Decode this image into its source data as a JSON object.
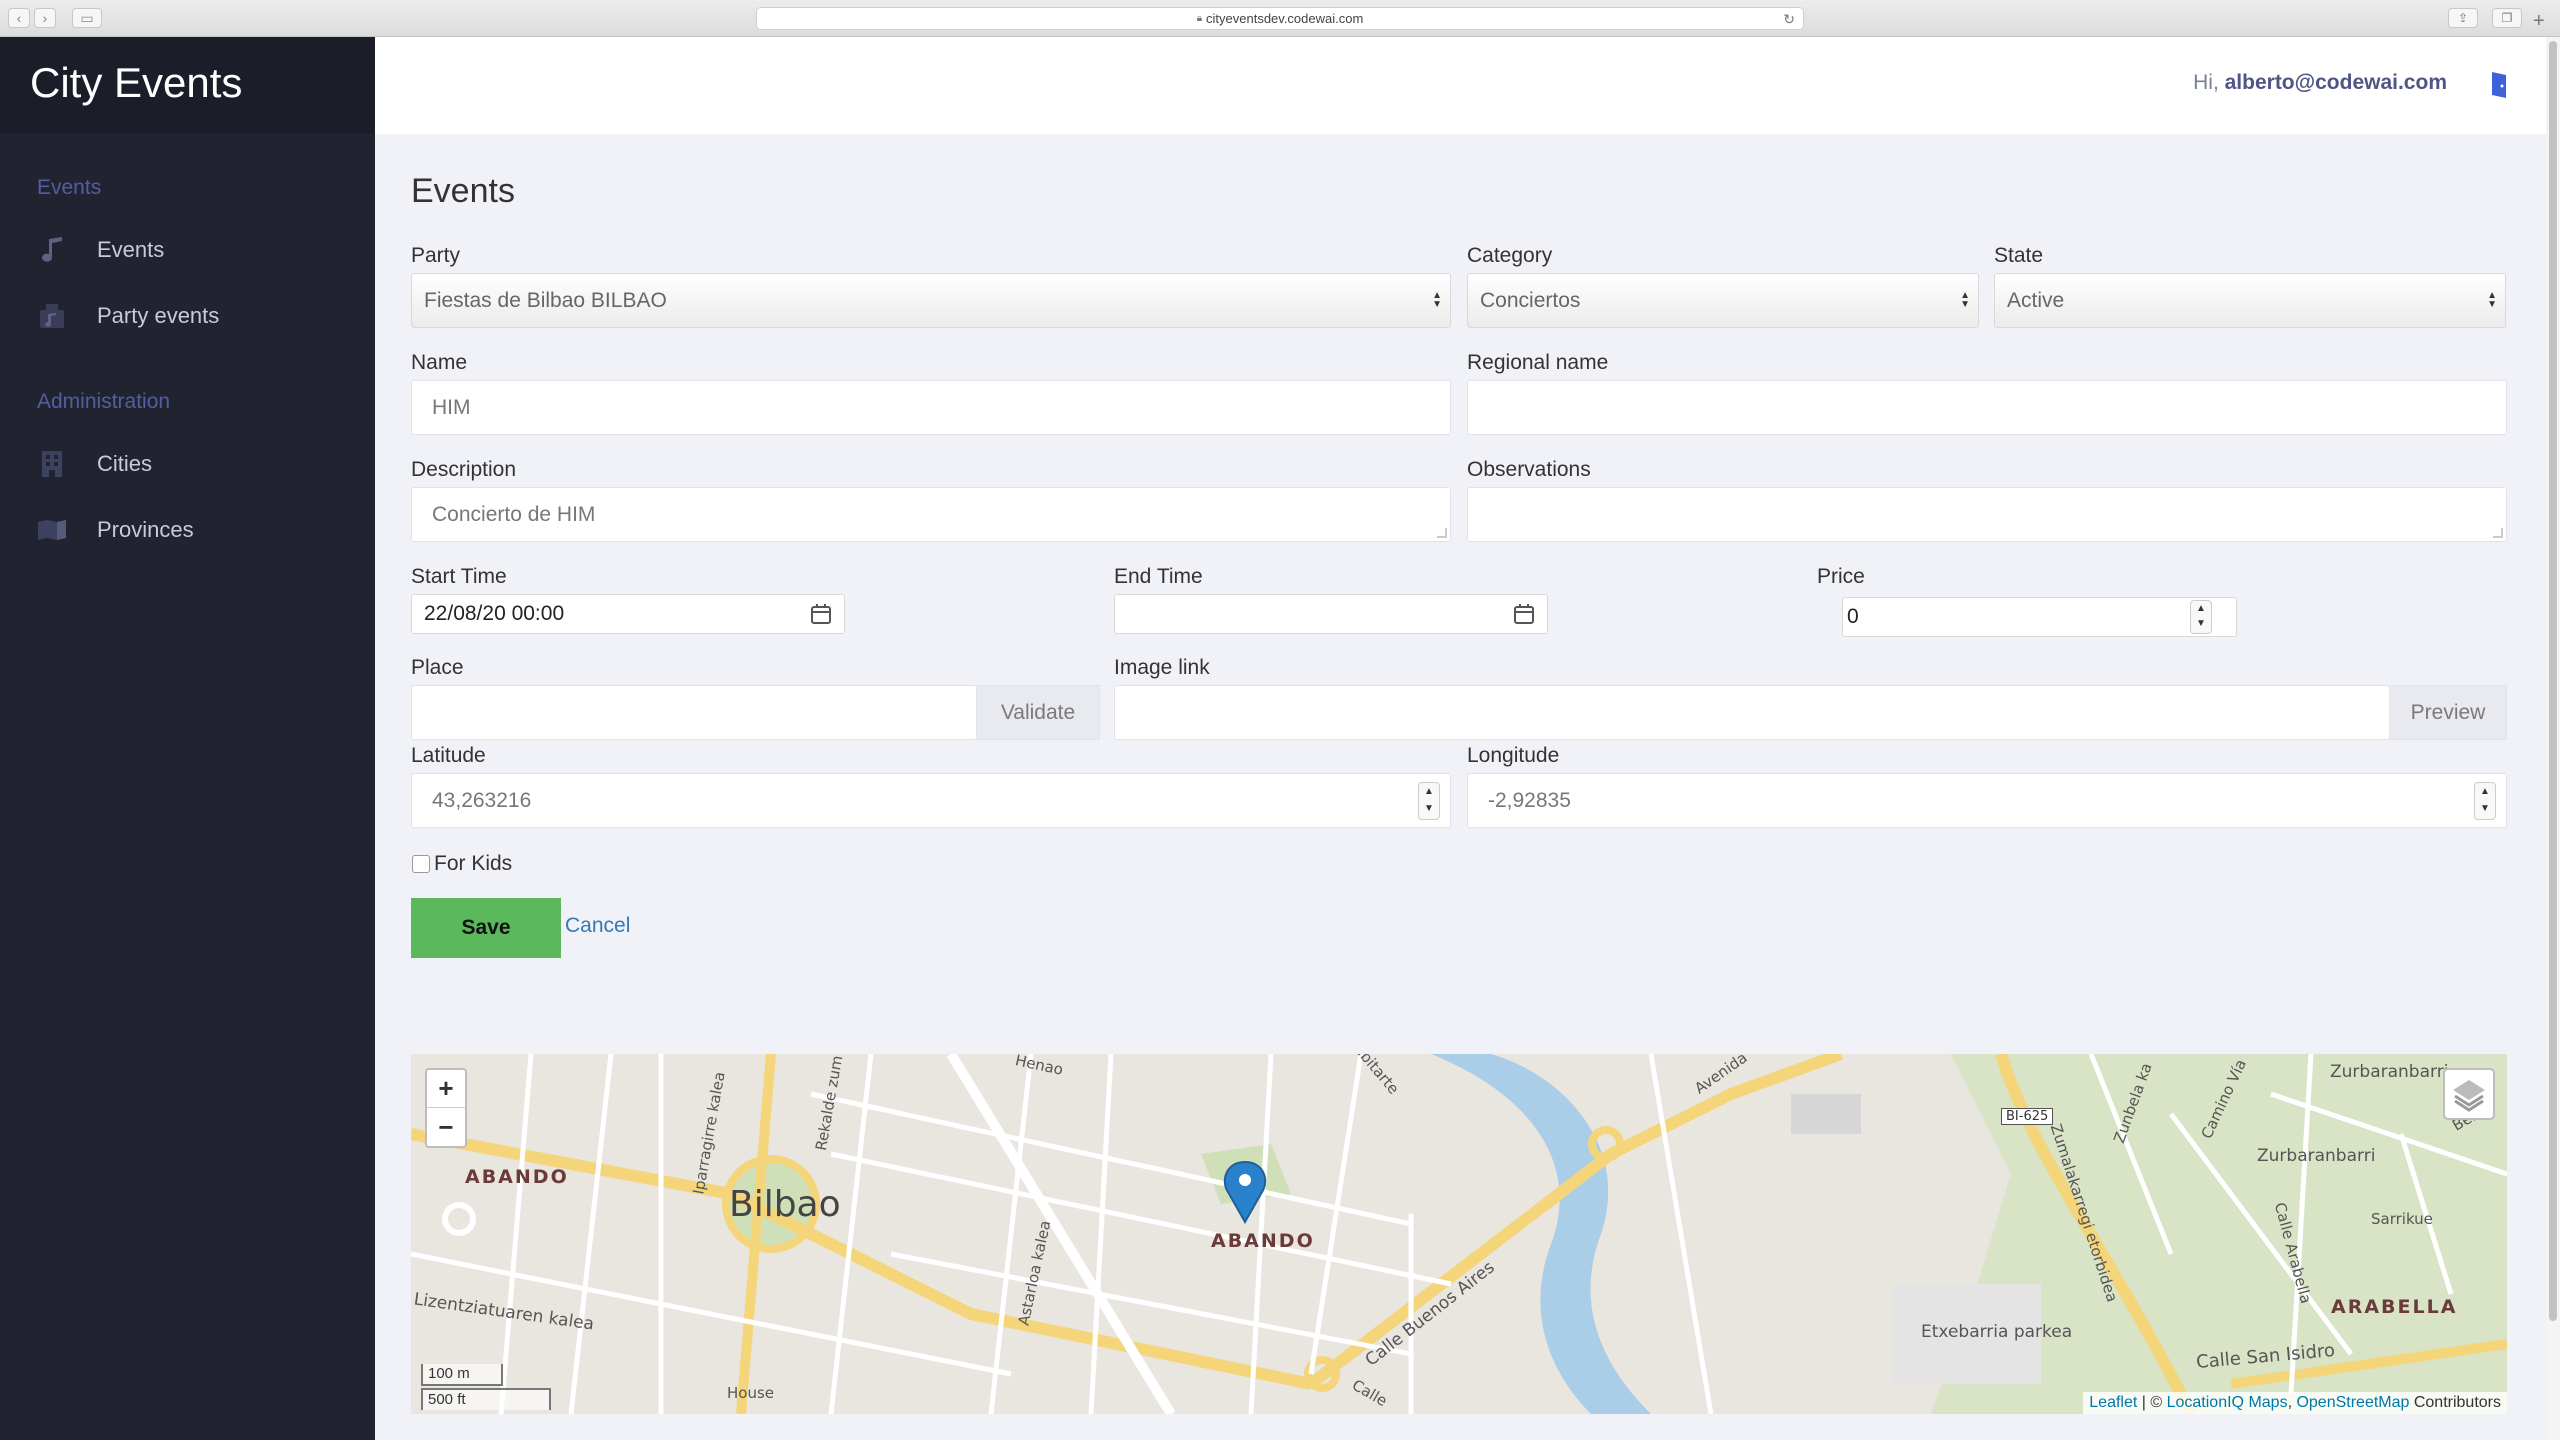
{
  "browser": {
    "url": "cityeventsdev.codewai.com"
  },
  "sidebar": {
    "brand": "City Events",
    "sections": [
      {
        "title": "Events",
        "items": [
          {
            "label": "Events",
            "icon": "music-note-icon"
          },
          {
            "label": "Party events",
            "icon": "party-icon"
          }
        ]
      },
      {
        "title": "Administration",
        "items": [
          {
            "label": "Cities",
            "icon": "building-icon"
          },
          {
            "label": "Provinces",
            "icon": "map-icon"
          }
        ]
      }
    ]
  },
  "header": {
    "greeting": "Hi,",
    "user": "alberto@codewai.com",
    "logout_icon": "logout-icon"
  },
  "form": {
    "title": "Events",
    "party": {
      "label": "Party",
      "value": "Fiestas de Bilbao BILBAO"
    },
    "category": {
      "label": "Category",
      "value": "Conciertos"
    },
    "state": {
      "label": "State",
      "value": "Active"
    },
    "name": {
      "label": "Name",
      "value": "HIM"
    },
    "regional_name": {
      "label": "Regional name",
      "value": ""
    },
    "description": {
      "label": "Description",
      "value": "Concierto de HIM"
    },
    "observations": {
      "label": "Observations",
      "value": ""
    },
    "start_time": {
      "label": "Start Time",
      "value": "22/08/20 00:00"
    },
    "end_time": {
      "label": "End Time",
      "value": ""
    },
    "price": {
      "label": "Price",
      "value": "0"
    },
    "place": {
      "label": "Place",
      "value": "",
      "button": "Validate"
    },
    "image_link": {
      "label": "Image link",
      "value": "",
      "button": "Preview"
    },
    "latitude": {
      "label": "Latitude",
      "value": "43,263216"
    },
    "longitude": {
      "label": "Longitude",
      "value": "-2,92835"
    },
    "for_kids": {
      "label": "For Kids",
      "checked": false
    },
    "save": "Save",
    "cancel": "Cancel"
  },
  "map": {
    "zoom_in": "+",
    "zoom_out": "−",
    "scale_metric": "100 m",
    "scale_imperial": "500 ft",
    "attribution": {
      "leaflet": "Leaflet",
      "sep1": " | © ",
      "locationiq": "LocationIQ Maps",
      "sep2": ", ",
      "osm": "OpenStreetMap",
      "contrib": " Contributors"
    },
    "labels": {
      "abando_left": "ABANDO",
      "bilbao": "Bilbao",
      "abando_center": "ABANDO",
      "arabella": "ARABELLA",
      "etxebarria": "Etxebarria parkea",
      "zurbaranbarri": "Zurbaranbarri",
      "zurbaranbarri_top": "Zurbaranbarri",
      "sarrikue": "Sarrikue",
      "bi625": "BI-625",
      "calle_buenos_aires": "Calle Buenos Aires",
      "calle_san_isidro": "Calle San Isidro",
      "henao": "Henao",
      "house": "House",
      "lizentziatuaren": "Lizentziatuaren kalea",
      "astarloa": "Astarloa kalea",
      "iparraguirre": "Iparragirre kalea",
      "rekalde": "Rekalde zum",
      "zumalakarregi": "Zumalakarregi etorbidea",
      "arabella_street": "Calle Arabella",
      "zunbela": "Zunbela ka",
      "camino": "Camino Vía",
      "avenida": "Avenida",
      "ibitarte": "Ibitarte",
      "berio": "Berio",
      "calle": "Calle"
    }
  }
}
